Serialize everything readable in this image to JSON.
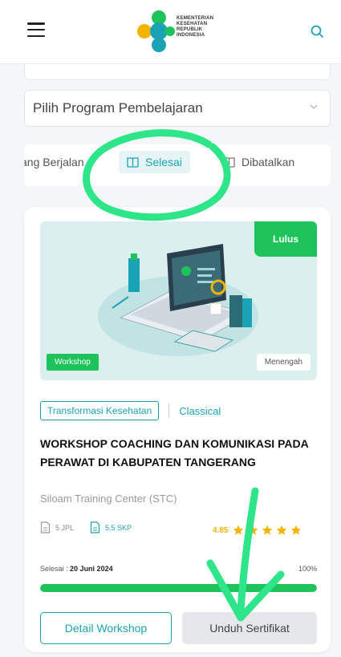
{
  "header": {
    "logo_text": [
      "KEMENTERIAN",
      "KESEHATAN",
      "REPUBLIK",
      "INDONESIA"
    ],
    "icons": {
      "menu": "hamburger-menu-icon",
      "search": "search-icon"
    }
  },
  "filter": {
    "program_select": "Pilih Program Pembelajaran"
  },
  "tabs": [
    {
      "label": "ang Berjalan",
      "active": false
    },
    {
      "label": "Selesai",
      "active": true
    },
    {
      "label": "Dibatalkan",
      "active": false
    }
  ],
  "course": {
    "status_badge": "Lulus",
    "type_badge": "Workshop",
    "level_badge": "Menengah",
    "category": "Transformasi Kesehatan",
    "method": "Classical",
    "title": "WORKSHOP COACHING DAN KOMUNIKASI PADA PERAWAT DI KABUPATEN TANGERANG",
    "provider": "Siloam Training Center (STC)",
    "jpl": "5 JPL",
    "skp": "5.5 SKP",
    "rating": "4.85",
    "stars": 4.85,
    "completed_label": "Selesai :",
    "completed_date": "20 Juni 2024",
    "progress_text": "100%",
    "progress": 1.0,
    "detail_button": "Detail Workshop",
    "certificate_button": "Unduh Sertifikat"
  },
  "colors": {
    "accent": "#1aa3b5",
    "success": "#1ec45b",
    "star": "#f3b400",
    "annotation": "#2ee58a"
  }
}
